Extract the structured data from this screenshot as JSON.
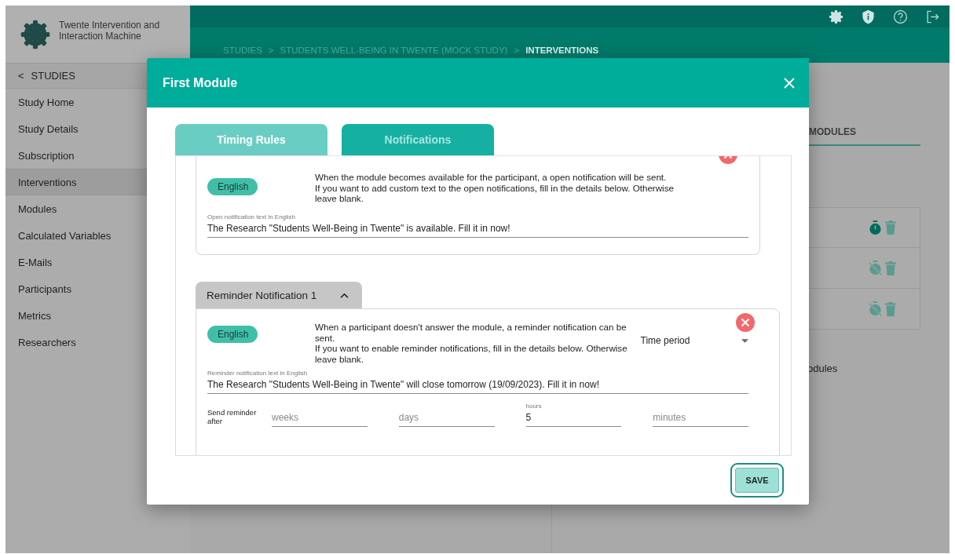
{
  "app": {
    "title": "Twente Intervention and Interaction Machine"
  },
  "breadcrumb": {
    "items": [
      {
        "label": "STUDIES",
        "selected": false
      },
      {
        "label": "STUDENTS WELL-BEING IN TWENTE (MOCK STUDY)",
        "selected": false
      },
      {
        "label": "INTERVENTIONS",
        "selected": true
      }
    ],
    "separators": [
      ">",
      ">"
    ]
  },
  "sidebar": {
    "back_label": "<",
    "title": "STUDIES",
    "items": [
      {
        "label": "Study Home",
        "selected": false
      },
      {
        "label": "Study Details",
        "selected": false
      },
      {
        "label": "Subscription",
        "selected": false
      },
      {
        "label": "Interventions",
        "selected": true
      },
      {
        "label": "Modules",
        "selected": false
      },
      {
        "label": "Calculated Variables",
        "selected": false
      },
      {
        "label": "E-Mails",
        "selected": false
      },
      {
        "label": "Participants",
        "selected": false
      },
      {
        "label": "Metrics",
        "selected": false
      },
      {
        "label": "Researchers",
        "selected": false
      }
    ]
  },
  "main": {
    "tabs": [
      {
        "label": "MODULES",
        "selected": true
      }
    ],
    "rows": [
      {
        "kind": "timer-on"
      },
      {
        "kind": "timer-off"
      },
      {
        "kind": "timer-off"
      }
    ],
    "partial_text": "odules"
  },
  "modal": {
    "title": "First Module",
    "tabs": [
      {
        "label": "Timing Rules",
        "selected": false
      },
      {
        "label": "Notifications",
        "selected": true
      }
    ],
    "open_notification": {
      "language": "English",
      "description": "When the module becomes available for the participant, a open notification will be sent.\nIf you want to add custom text to the open notifications, fill in the details below. Otherwise leave blank.",
      "field_label": "Open notification text in English",
      "value": "The Research \"Students Well-Being in Twente\" is available. Fill it in now!"
    },
    "reminders": [
      {
        "title": "Reminder Notification 1",
        "expanded": true,
        "language": "English",
        "description": "When a participant doesn't answer the module, a reminder notification can be sent.\nIf you want to enable reminder notifications, fill in the details below. Otherwise leave blank.",
        "select_value": "Time period",
        "field_label": "Reminder notification text in English",
        "value": "The Research \"Students Well-Being in Twente\" will close tomorrow (19/09/2023). Fill it in now!",
        "send_label": "Send reminder after",
        "durations": [
          {
            "placeholder": "weeks"
          },
          {
            "placeholder": "days"
          },
          {
            "label": "hours",
            "value": "5"
          },
          {
            "placeholder": "minutes"
          }
        ]
      }
    ],
    "save_button": "SAVE"
  }
}
